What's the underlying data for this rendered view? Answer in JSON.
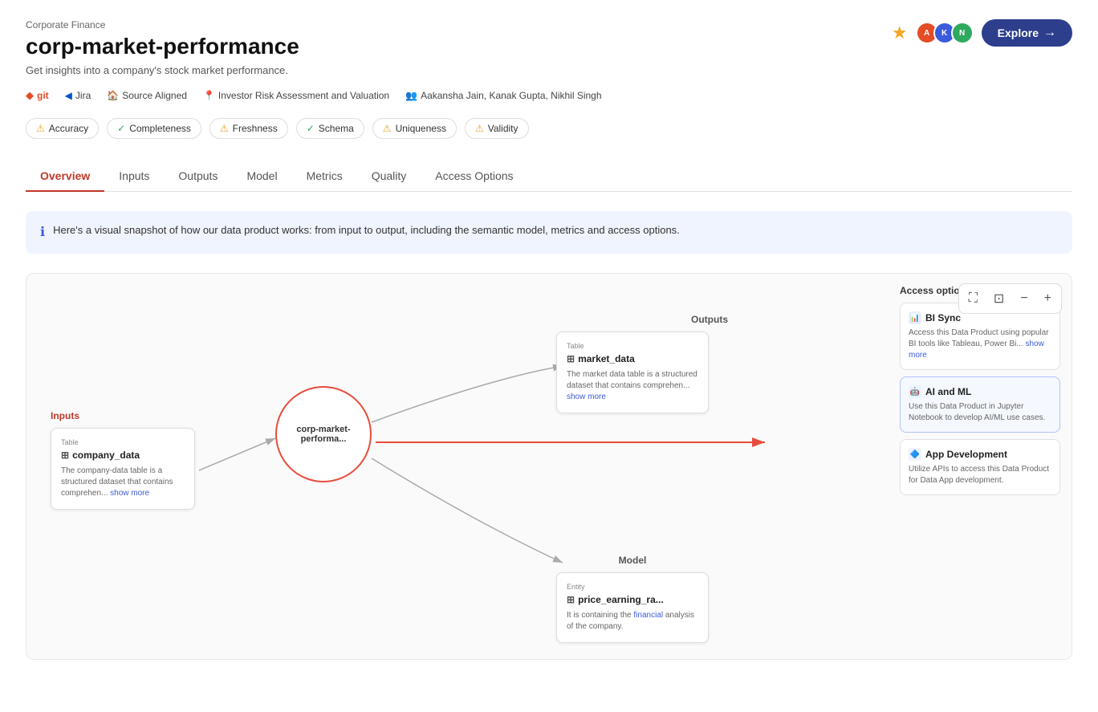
{
  "page": {
    "breadcrumb": "Corporate Finance",
    "title": "corp-market-performance",
    "subtitle": "Get insights into a company's stock market performance.",
    "meta": [
      {
        "id": "git",
        "icon": "git",
        "label": "git"
      },
      {
        "id": "jira",
        "icon": "jira",
        "label": "Jira"
      },
      {
        "id": "source",
        "icon": "source",
        "label": "Source Aligned"
      },
      {
        "id": "risk",
        "icon": "risk",
        "label": "Investor Risk Assessment and Valuation"
      },
      {
        "id": "authors",
        "icon": "authors",
        "label": "Aakansha Jain, Kanak Gupta, Nikhil Singh"
      }
    ],
    "badges": [
      {
        "label": "Accuracy",
        "status": "warn"
      },
      {
        "label": "Completeness",
        "status": "ok"
      },
      {
        "label": "Freshness",
        "status": "warn"
      },
      {
        "label": "Schema",
        "status": "ok"
      },
      {
        "label": "Uniqueness",
        "status": "warn"
      },
      {
        "label": "Validity",
        "status": "warn"
      }
    ],
    "tabs": [
      {
        "label": "Overview",
        "active": true
      },
      {
        "label": "Inputs",
        "active": false
      },
      {
        "label": "Outputs",
        "active": false
      },
      {
        "label": "Model",
        "active": false
      },
      {
        "label": "Metrics",
        "active": false
      },
      {
        "label": "Quality",
        "active": false
      },
      {
        "label": "Access Options",
        "active": false
      }
    ],
    "explore_btn": "Explore",
    "info_text": "Here's a visual snapshot of how our data product works: from input to output, including the semantic model, metrics and access options."
  },
  "diagram": {
    "inputs_label": "Inputs",
    "outputs_label": "Outputs",
    "model_label": "Model",
    "access_label": "Access options",
    "center_node": "corp-market-performa...",
    "input_card": {
      "type_label": "Table",
      "title": "company_data",
      "desc": "The company-data table is a structured dataset that contains comprehen...",
      "link": "show more"
    },
    "output_card": {
      "type_label": "Table",
      "title": "market_data",
      "desc": "The market data table is a structured dataset that contains comprehen...",
      "link": "show more"
    },
    "model_card": {
      "type_label": "Entity",
      "title": "price_earning_ra...",
      "desc": "It is containing the financial analysis of the company."
    },
    "access_cards": [
      {
        "id": "bi-sync",
        "icon_type": "bi",
        "icon_label": "BI",
        "title": "BI Sync",
        "desc": "Access this Data Product using popular BI tools like Tableau, Power Bi...",
        "link": "show more"
      },
      {
        "id": "ai-ml",
        "icon_type": "ai",
        "icon_label": "AI",
        "title": "AI and ML",
        "desc": "Use this Data Product in Jupyter Notebook to develop AI/ML use cases."
      },
      {
        "id": "app-dev",
        "icon_type": "app",
        "icon_label": "AP",
        "title": "App Development",
        "desc": "Utilize APIs to access this Data Product for Data App development."
      }
    ]
  },
  "controls": {
    "fullscreen": "⛶",
    "fit": "⊡",
    "zoom_out": "−",
    "zoom_in": "+"
  }
}
